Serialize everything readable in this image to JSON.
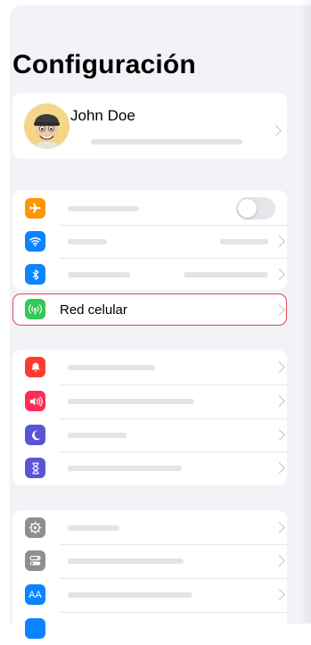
{
  "title": "Configuración",
  "profile": {
    "name": "John Doe"
  },
  "highlighted_row": {
    "label": "Red celular",
    "icon": "antenna-icon",
    "icon_color": "#34c759"
  },
  "group1": [
    {
      "icon": "airplane-icon",
      "icon_color": "#ff9500",
      "control": "toggle",
      "toggle_on": false
    },
    {
      "icon": "wifi-icon",
      "icon_color": "#0a84ff",
      "control": "chevron"
    },
    {
      "icon": "bluetooth-icon",
      "icon_color": "#0a84ff",
      "control": "chevron"
    }
  ],
  "group2": [
    {
      "icon": "bell-icon",
      "icon_color": "#ff3b30"
    },
    {
      "icon": "speaker-icon",
      "icon_color": "#ff2d55"
    },
    {
      "icon": "moon-icon",
      "icon_color": "#5856d6"
    },
    {
      "icon": "hourglass-icon",
      "icon_color": "#5856d6"
    }
  ],
  "group3": [
    {
      "icon": "gear-icon",
      "icon_color": "#8e8e93"
    },
    {
      "icon": "toggles-icon",
      "icon_color": "#8e8e93"
    },
    {
      "icon": "text-size-icon",
      "icon_color": "#0a84ff",
      "icon_text": "AA"
    }
  ]
}
